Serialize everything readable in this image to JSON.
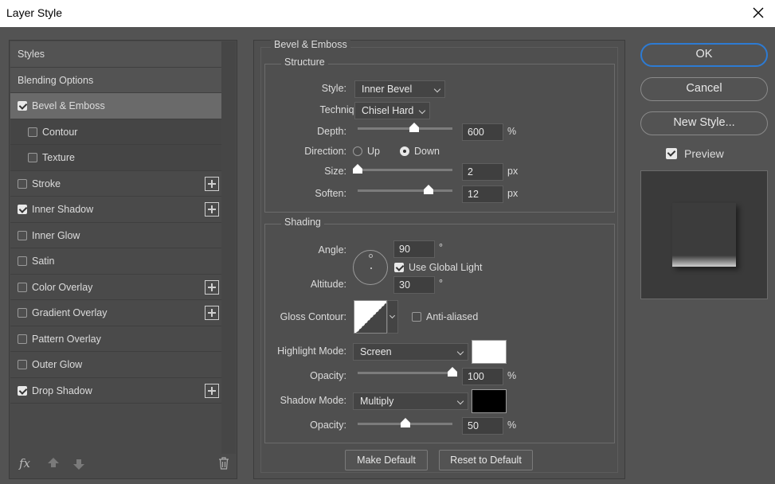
{
  "window": {
    "title": "Layer Style"
  },
  "styles_list": {
    "items": [
      {
        "label": "Styles",
        "type": "header"
      },
      {
        "label": "Blending Options",
        "type": "header"
      },
      {
        "label": "Bevel & Emboss",
        "checked": true,
        "selected": true
      },
      {
        "label": "Contour",
        "checked": false,
        "sub": true
      },
      {
        "label": "Texture",
        "checked": false,
        "sub": true
      },
      {
        "label": "Stroke",
        "checked": false,
        "plus": true
      },
      {
        "label": "Inner Shadow",
        "checked": true,
        "plus": true
      },
      {
        "label": "Inner Glow",
        "checked": false
      },
      {
        "label": "Satin",
        "checked": false
      },
      {
        "label": "Color Overlay",
        "checked": false,
        "plus": true
      },
      {
        "label": "Gradient Overlay",
        "checked": false,
        "plus": true
      },
      {
        "label": "Pattern Overlay",
        "checked": false
      },
      {
        "label": "Outer Glow",
        "checked": false
      },
      {
        "label": "Drop Shadow",
        "checked": true,
        "plus": true
      }
    ],
    "bottom": {
      "fx_label": "fx"
    }
  },
  "bevel": {
    "section_title": "Bevel & Emboss",
    "structure": {
      "title": "Structure",
      "style_label": "Style:",
      "style_value": "Inner Bevel",
      "technique_label": "Technique:",
      "technique_value": "Chisel Hard",
      "depth_label": "Depth:",
      "depth_value": "600",
      "depth_unit": "%",
      "depth_slider_fraction": 0.6,
      "direction_label": "Direction:",
      "direction_up": "Up",
      "direction_down": "Down",
      "direction_selected": "Down",
      "size_label": "Size:",
      "size_value": "2",
      "size_unit": "px",
      "size_slider_fraction": 0.0,
      "soften_label": "Soften:",
      "soften_value": "12",
      "soften_unit": "px",
      "soften_slider_fraction": 0.75
    },
    "shading": {
      "title": "Shading",
      "angle_label": "Angle:",
      "angle_value": "90",
      "angle_unit": "°",
      "global_light_label": "Use Global Light",
      "global_light_checked": true,
      "altitude_label": "Altitude:",
      "altitude_value": "30",
      "altitude_unit": "°",
      "gloss_label": "Gloss Contour:",
      "anti_aliased_label": "Anti-aliased",
      "anti_aliased_checked": false,
      "highlight_mode_label": "Highlight Mode:",
      "highlight_mode_value": "Screen",
      "highlight_color": "#ffffff",
      "highlight_opacity_label": "Opacity:",
      "highlight_opacity_value": "100",
      "highlight_opacity_unit": "%",
      "highlight_opacity_fraction": 1.0,
      "shadow_mode_label": "Shadow Mode:",
      "shadow_mode_value": "Multiply",
      "shadow_color": "#000000",
      "shadow_opacity_label": "Opacity:",
      "shadow_opacity_value": "50",
      "shadow_opacity_unit": "%",
      "shadow_opacity_fraction": 0.5
    },
    "make_default_label": "Make Default",
    "reset_default_label": "Reset to Default"
  },
  "actions": {
    "ok_label": "OK",
    "cancel_label": "Cancel",
    "new_style_label": "New Style...",
    "preview_label": "Preview",
    "preview_checked": true
  }
}
